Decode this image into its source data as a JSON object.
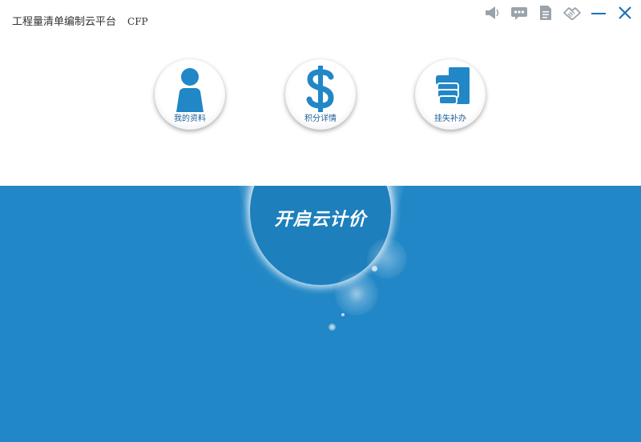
{
  "window": {
    "title": "工程量清单编制云平台",
    "code": "CFP"
  },
  "toolbar": {
    "icons": [
      "speaker-icon",
      "chat-icon",
      "document-icon",
      "handshake-icon",
      "minimize-icon",
      "close-icon"
    ],
    "icon_color": "#9aa3ab",
    "accent_color": "#1e72b8"
  },
  "features": [
    {
      "label": "我的资料",
      "icon": "person-icon"
    },
    {
      "label": "积分详情",
      "icon": "dollar-icon"
    },
    {
      "label": "挂失补办",
      "icon": "card-hand-icon"
    }
  ],
  "main": {
    "start_label": "开启云计价",
    "background_color": "#2187c6"
  }
}
